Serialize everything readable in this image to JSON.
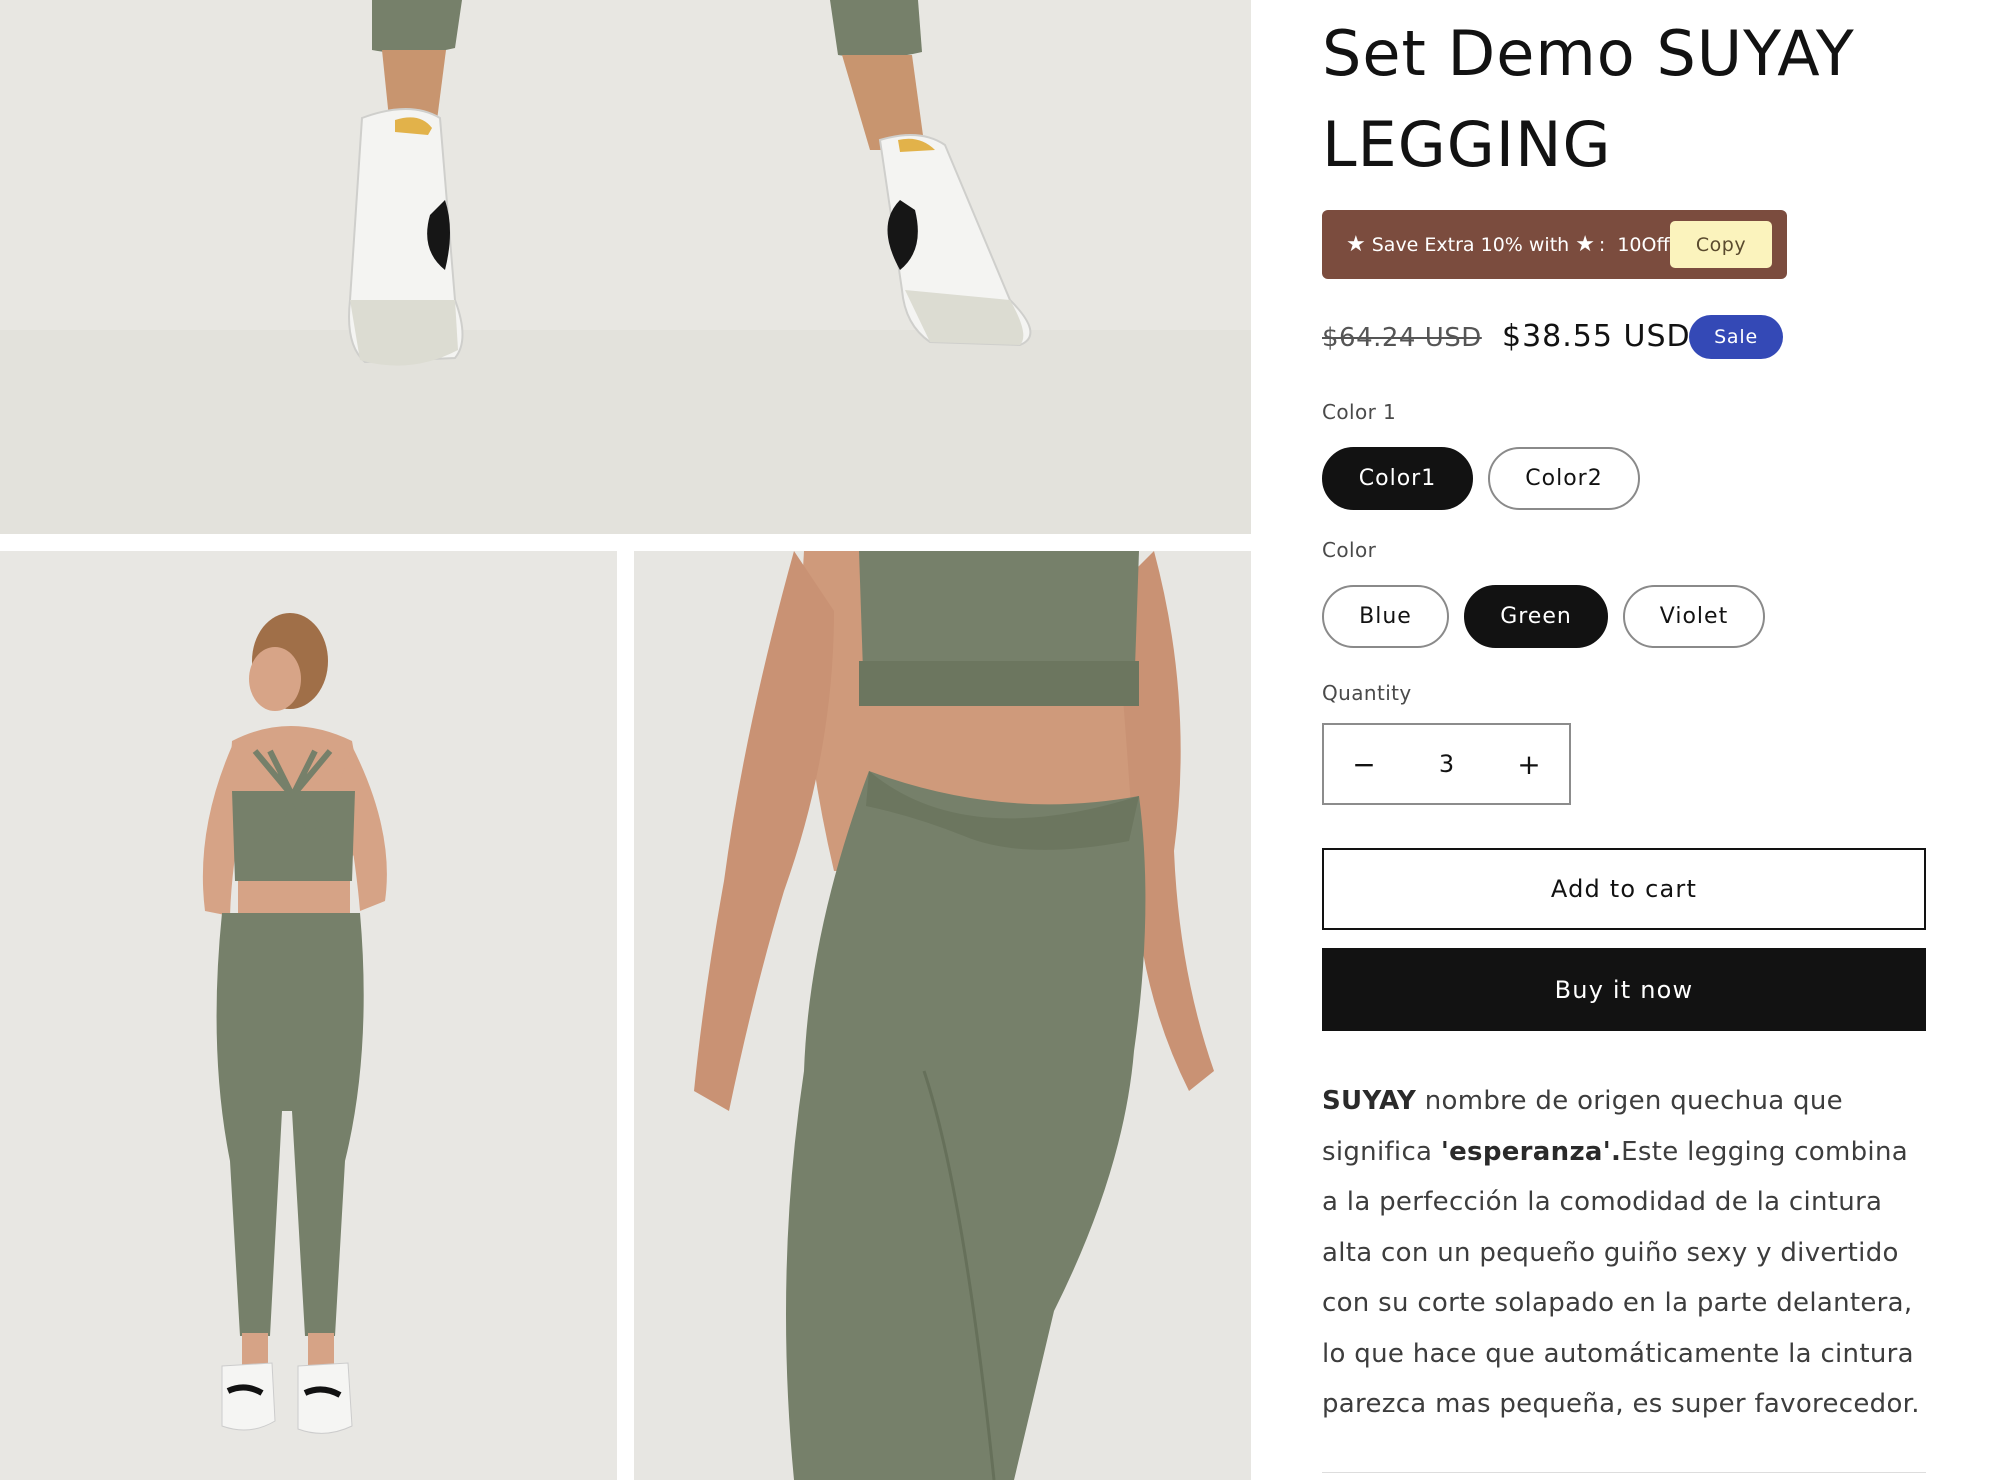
{
  "product": {
    "title": "Set Demo SUYAY LEGGING",
    "promo": {
      "prefix": "Save Extra 10% with",
      "separator": ":",
      "code": "10Off",
      "copy_label": "Copy",
      "background": "#7b4c3e"
    },
    "price": {
      "regular": "$64.24 USD",
      "sale": "$38.55 USD",
      "badge": "Sale",
      "badge_color": "#3449b6"
    },
    "options": [
      {
        "label": "Color 1",
        "values": [
          "Color1",
          "Color2"
        ],
        "selected": "Color1"
      },
      {
        "label": "Color",
        "values": [
          "Blue",
          "Green",
          "Violet"
        ],
        "selected": "Green"
      }
    ],
    "quantity": {
      "label": "Quantity",
      "value": "3",
      "decrease_icon": "minus-icon",
      "increase_icon": "plus-icon"
    },
    "add_to_cart": "Add to cart",
    "buy_now": "Buy it now",
    "description": {
      "bold1": "SUYAY",
      "text1": " nombre de origen quechua que significa ",
      "bold2": "'esperanza'.",
      "text2": "Este legging combina a la perfección la comodidad de la cintura alta con un pequeño guiño sexy y divertido con su corte solapado en la parte delantera, lo que hace que automáticamente la cintura parezca mas pequeña, es super favorecedor."
    }
  },
  "colors": {
    "legging_green": "#76806a",
    "photo_background": "#e6e5e1"
  }
}
